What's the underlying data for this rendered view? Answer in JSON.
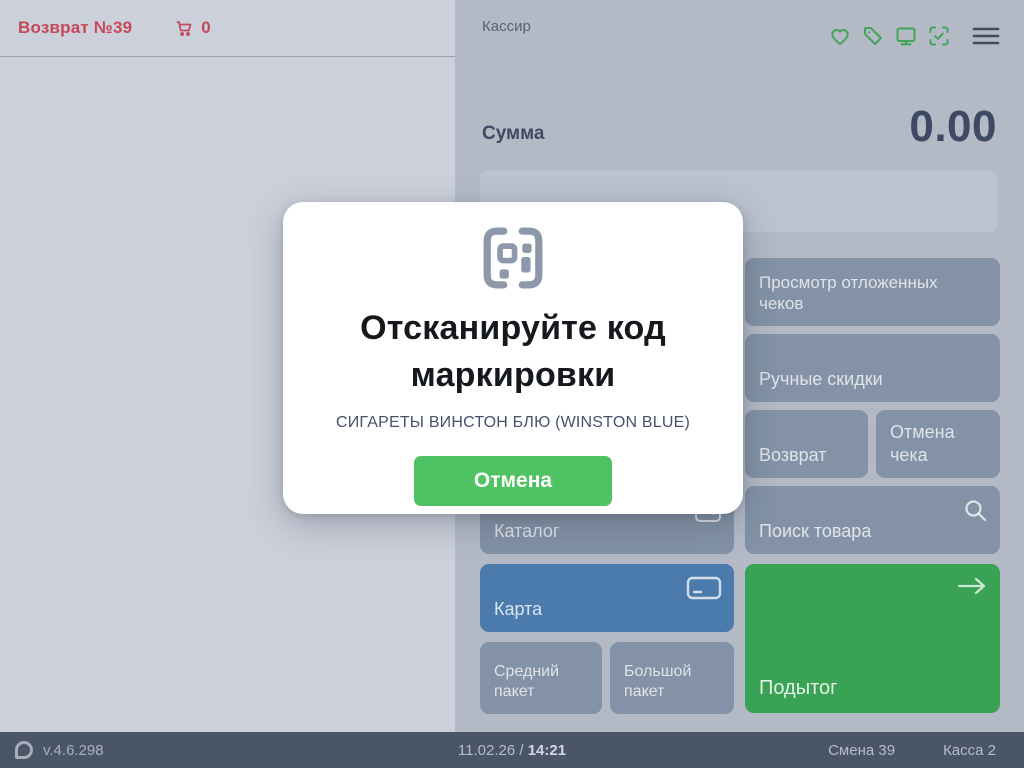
{
  "colors": {
    "accent-red": "#c5495a",
    "accent-green": "#43a45c",
    "left-bg": "#cbd0da",
    "right-bg": "#b3bac6",
    "button-gray": "#8392a6",
    "button-blue": "#4b7bac",
    "subtotal-green": "#39a254",
    "cancel-green": "#4fc363",
    "footer-bg": "#4a5568"
  },
  "receipt_header": {
    "title": "Возврат №39",
    "cart_count": "0"
  },
  "control_header": {
    "cashier_label": "Кассир"
  },
  "icons": {
    "toolbar": [
      "heart-icon",
      "tag-icon",
      "display-icon",
      "scan-check-icon",
      "menu-icon"
    ],
    "cart": "cart-icon",
    "search": "search-icon",
    "card": "card-icon",
    "catalog": "catalog-icon",
    "subtotal_arrow": "arrow-right-icon",
    "modal": "marking-code-icon",
    "footer_logo": "app-logo"
  },
  "sum": {
    "label": "Сумма",
    "value": "0.00"
  },
  "barcode_input": {
    "value": ""
  },
  "panel_buttons": {
    "pending": {
      "label": "Просмотр отложенных чеков"
    },
    "discounts": {
      "label": "Ручные скидки"
    },
    "refund": {
      "label": "Возврат"
    },
    "cancel_receipt": {
      "label": "Отмена чека"
    },
    "catalog": {
      "label": "Каталог"
    },
    "search": {
      "label": "Поиск товара"
    },
    "card": {
      "label": "Карта"
    },
    "subtotal": {
      "label": "Подытог"
    },
    "bag_medium": {
      "label": "Средний пакет"
    },
    "bag_large": {
      "label": "Большой пакет"
    }
  },
  "modal": {
    "title": "Отсканируйте код маркировки",
    "product_name": "СИГАРЕТЫ ВИНСТОН БЛЮ (WINSTON BLUE)",
    "cancel_label": "Отмена"
  },
  "footer": {
    "version": "v.4.6.298",
    "date": "11.02.26 /",
    "time": "14:21",
    "shift": "Смена 39",
    "register": "Касса 2"
  }
}
